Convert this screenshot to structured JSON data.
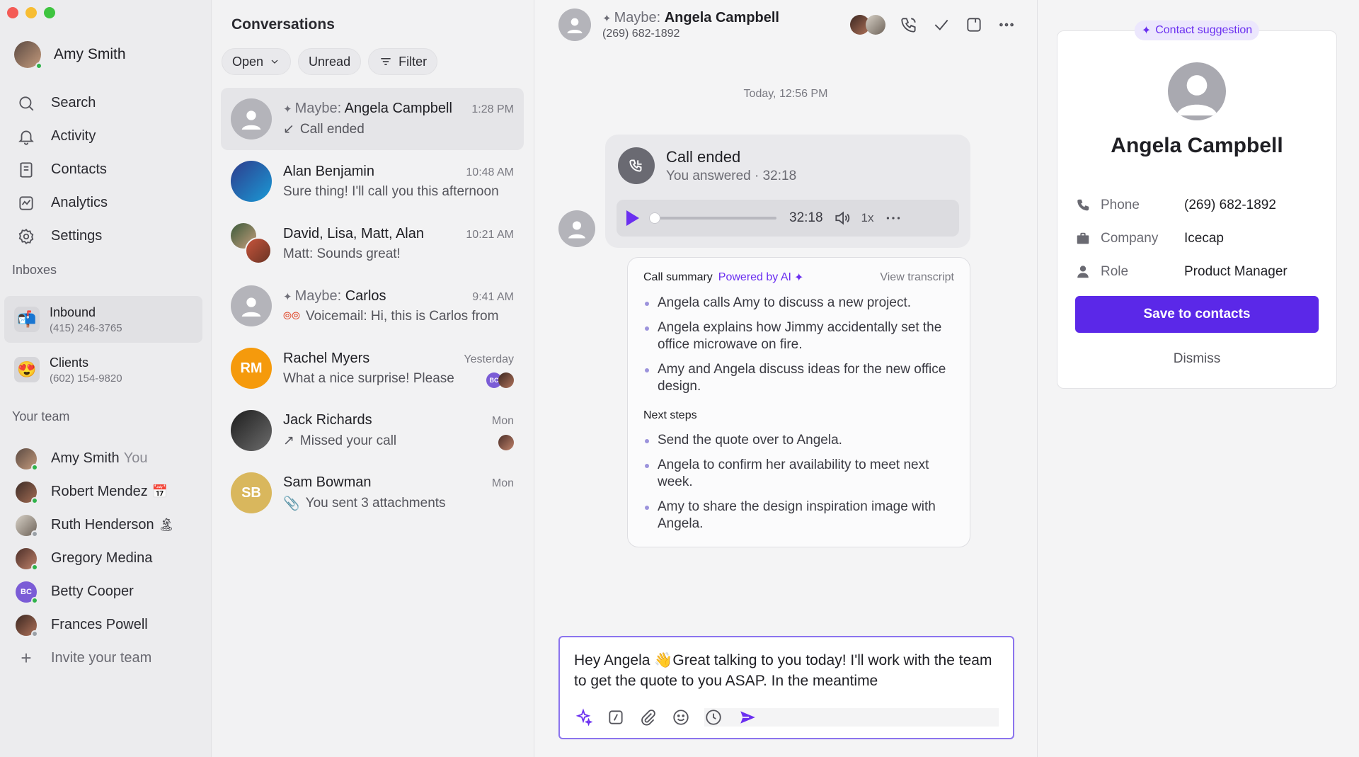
{
  "user": {
    "name": "Amy Smith"
  },
  "nav": [
    {
      "label": "Search"
    },
    {
      "label": "Activity"
    },
    {
      "label": "Contacts"
    },
    {
      "label": "Analytics"
    },
    {
      "label": "Settings"
    }
  ],
  "inboxes": {
    "label": "Inboxes",
    "items": [
      {
        "name": "Inbound",
        "number": "(415) 246-3765"
      },
      {
        "name": "Clients",
        "number": "(602) 154-9820"
      }
    ]
  },
  "team": {
    "label": "Your team",
    "you_label": "You",
    "members": [
      {
        "name": "Amy Smith"
      },
      {
        "name": "Robert Mendez"
      },
      {
        "name": "Ruth Henderson"
      },
      {
        "name": "Gregory Medina"
      },
      {
        "name": "Betty Cooper",
        "initials": "BC"
      },
      {
        "name": "Frances Powell"
      }
    ],
    "invite": "Invite your team"
  },
  "conversations": {
    "title": "Conversations",
    "filters": {
      "open": "Open",
      "unread": "Unread",
      "filter": "Filter"
    },
    "items": [
      {
        "prefix": "Maybe:",
        "name": "Angela Campbell",
        "time": "1:28 PM",
        "preview": "Call ended"
      },
      {
        "name": "Alan Benjamin",
        "time": "10:48 AM",
        "preview": "Sure thing! I'll call you this afternoon"
      },
      {
        "name": "David, Lisa, Matt, Alan",
        "time": "10:21 AM",
        "preview": "Matt: Sounds great!"
      },
      {
        "prefix": "Maybe:",
        "name": "Carlos",
        "time": "9:41 AM",
        "preview": "Voicemail: Hi, this is Carlos from"
      },
      {
        "name": "Rachel Myers",
        "initials": "RM",
        "time": "Yesterday",
        "preview": "What a nice surprise! Please",
        "badge": "BC"
      },
      {
        "name": "Jack Richards",
        "time": "Mon",
        "preview": "Missed your call"
      },
      {
        "name": "Sam Bowman",
        "initials": "SB",
        "time": "Mon",
        "preview": "You sent 3 attachments"
      }
    ]
  },
  "chat": {
    "header": {
      "prefix": "Maybe:",
      "name": "Angela Campbell",
      "phone": "(269) 682-1892"
    },
    "date": "Today, 12:56 PM",
    "call": {
      "title": "Call ended",
      "subtitle": "You answered · 32:18",
      "duration": "32:18",
      "speed": "1x",
      "progress": 0
    },
    "summary": {
      "title": "Call summary",
      "powered": "Powered by AI",
      "view_transcript": "View transcript",
      "bullets": [
        "Angela calls Amy to discuss a new project.",
        "Angela explains how Jimmy accidentally set the office microwave on fire.",
        "Amy and Angela discuss ideas for the new office design."
      ],
      "next_steps_label": "Next steps",
      "next_steps": [
        "Send the quote over to Angela.",
        "Angela to confirm her availability to meet next week.",
        "Amy to share the design inspiration image with Angela."
      ]
    },
    "composer": {
      "text": "Hey Angela 👋Great talking to you today! I'll work with the team to get the quote to you ASAP. In the meantime"
    }
  },
  "contact": {
    "badge": "Contact suggestion",
    "name": "Angela Campbell",
    "fields": [
      {
        "label": "Phone",
        "value": "(269) 682-1892"
      },
      {
        "label": "Company",
        "value": "Icecap"
      },
      {
        "label": "Role",
        "value": "Product Manager"
      }
    ],
    "save": "Save to contacts",
    "dismiss": "Dismiss"
  },
  "colors": {
    "accent": "#5b28e8",
    "accent_light": "#ece7fd",
    "presence": "#2fb34a",
    "rm_avatar": "#f59a0c",
    "sb_avatar": "#d9b75d",
    "bc_avatar": "#7b5cd6"
  }
}
